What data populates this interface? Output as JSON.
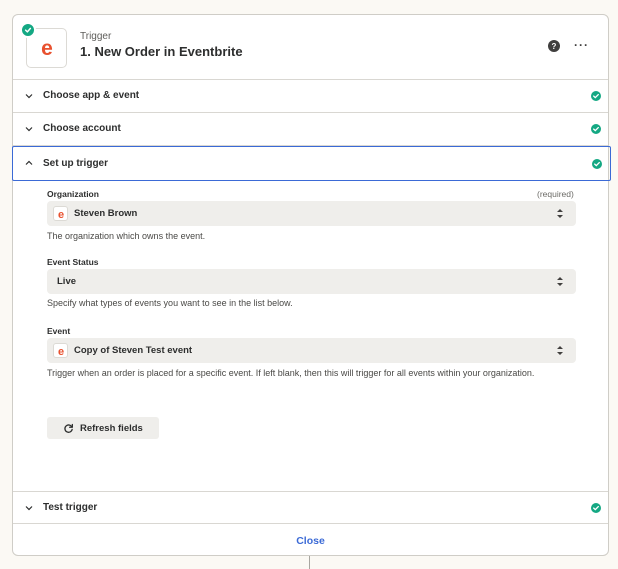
{
  "header": {
    "kind": "Trigger",
    "title": "1. New Order in Eventbrite",
    "help_icon": "?",
    "more_icon": "···",
    "app_letter": "e"
  },
  "sections": {
    "choose_app": {
      "label": "Choose app & event"
    },
    "choose_account": {
      "label": "Choose account"
    },
    "setup_trigger": {
      "label": "Set up trigger"
    },
    "test_trigger": {
      "label": "Test trigger"
    }
  },
  "form": {
    "organization": {
      "label": "Organization",
      "required": "(required)",
      "value": "Steven Brown",
      "help": "The organization which owns the event."
    },
    "event_status": {
      "label": "Event Status",
      "value": "Live",
      "help": "Specify what types of events you want to see in the list below."
    },
    "event": {
      "label": "Event",
      "value": "Copy of Steven Test event",
      "help": "Trigger when an order is placed for a specific event. If left blank, then this will trigger for all events within your organization."
    },
    "refresh_label": "Refresh fields"
  },
  "footer": {
    "close_label": "Close"
  },
  "colors": {
    "accent": "#3b6ad6",
    "success": "#14a883",
    "brand_eventbrite": "#e8512f"
  }
}
